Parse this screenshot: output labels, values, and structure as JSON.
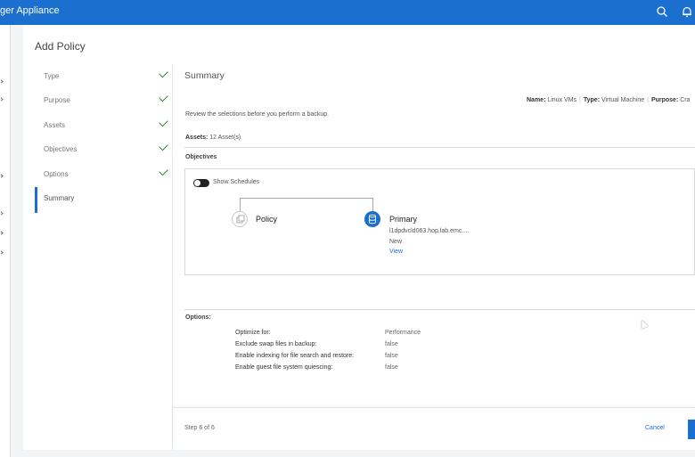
{
  "app": {
    "title": "ger Appliance"
  },
  "dialog": {
    "title": "Add Policy"
  },
  "steps": [
    {
      "label": "Type",
      "complete": true
    },
    {
      "label": "Purpose",
      "complete": true
    },
    {
      "label": "Assets",
      "complete": true
    },
    {
      "label": "Objectives",
      "complete": true
    },
    {
      "label": "Options",
      "complete": true
    },
    {
      "label": "Summary",
      "complete": false,
      "active": true
    }
  ],
  "summary": {
    "title": "Summary",
    "name_key": "Name:",
    "name_val": "Linux VMs",
    "type_key": "Type:",
    "type_val": "Virtual Machine",
    "purpose_key": "Purpose:",
    "purpose_val": "Cra",
    "review_text": "Review the selections before you perform a backup.",
    "assets_key": "Assets:",
    "assets_val": "12 Asset(s)",
    "objectives_label": "Objectives",
    "show_schedules": "Show Schedules",
    "policy_label": "Policy",
    "primary_label": "Primary",
    "primary_host": "l1dpdvcld063.hop.lab.emc....",
    "primary_status": "New",
    "primary_view": "View",
    "options_label": "Options:",
    "options": [
      {
        "key": "Optimize for:",
        "value": "Performance"
      },
      {
        "key": "Exclude swap files in backup:",
        "value": "false"
      },
      {
        "key": "Enable indexing for file search and restore:",
        "value": "false"
      },
      {
        "key": "Enable guest file system quiescing:",
        "value": "false"
      }
    ]
  },
  "footer": {
    "step_count": "Step 6 of 6",
    "cancel": "Cancel"
  },
  "colors": {
    "brand": "#1a6fcf",
    "check": "#2e7d32"
  },
  "icons": [
    "search-icon",
    "bell-icon",
    "policy-copy-icon",
    "primary-database-icon",
    "check-icon"
  ]
}
